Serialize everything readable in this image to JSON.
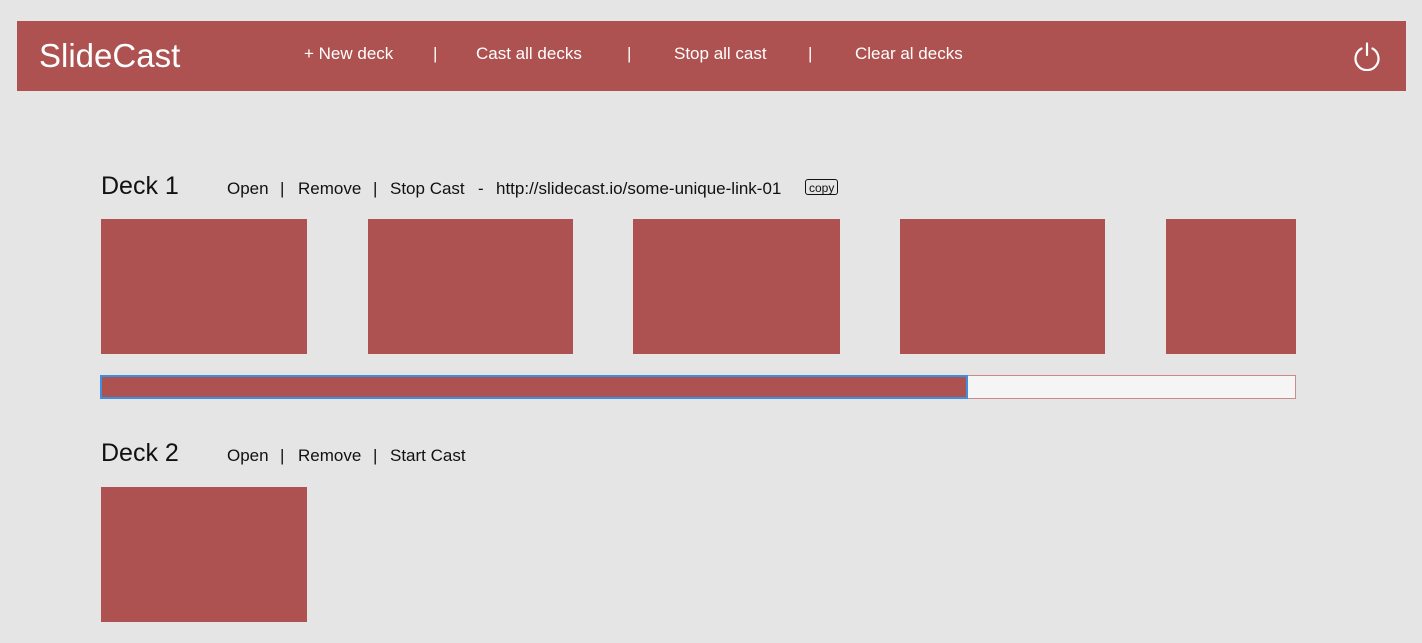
{
  "app": {
    "title": "SlideCast"
  },
  "topnav": {
    "new_deck": "+ New deck",
    "cast_all": "Cast all decks",
    "stop_all": "Stop all cast",
    "clear_all": "Clear al decks",
    "separator": "|",
    "power_icon": "power-icon"
  },
  "decks": [
    {
      "title": "Deck 1",
      "actions": {
        "open": "Open",
        "remove": "Remove",
        "cast": "Stop Cast"
      },
      "separator": "|",
      "link_dash": "-",
      "link": "http://slidecast.io/some-unique-link-01",
      "copy_label": "copy",
      "slide_count_visible": 5,
      "progress_fraction": 0.726
    },
    {
      "title": "Deck 2",
      "actions": {
        "open": "Open",
        "remove": "Remove",
        "cast": "Start Cast"
      },
      "separator": "|",
      "slide_count_visible": 1
    }
  ],
  "colors": {
    "accent": "#ad5250",
    "background": "#e5e5e5",
    "progress_focus": "#3d8fe0"
  }
}
